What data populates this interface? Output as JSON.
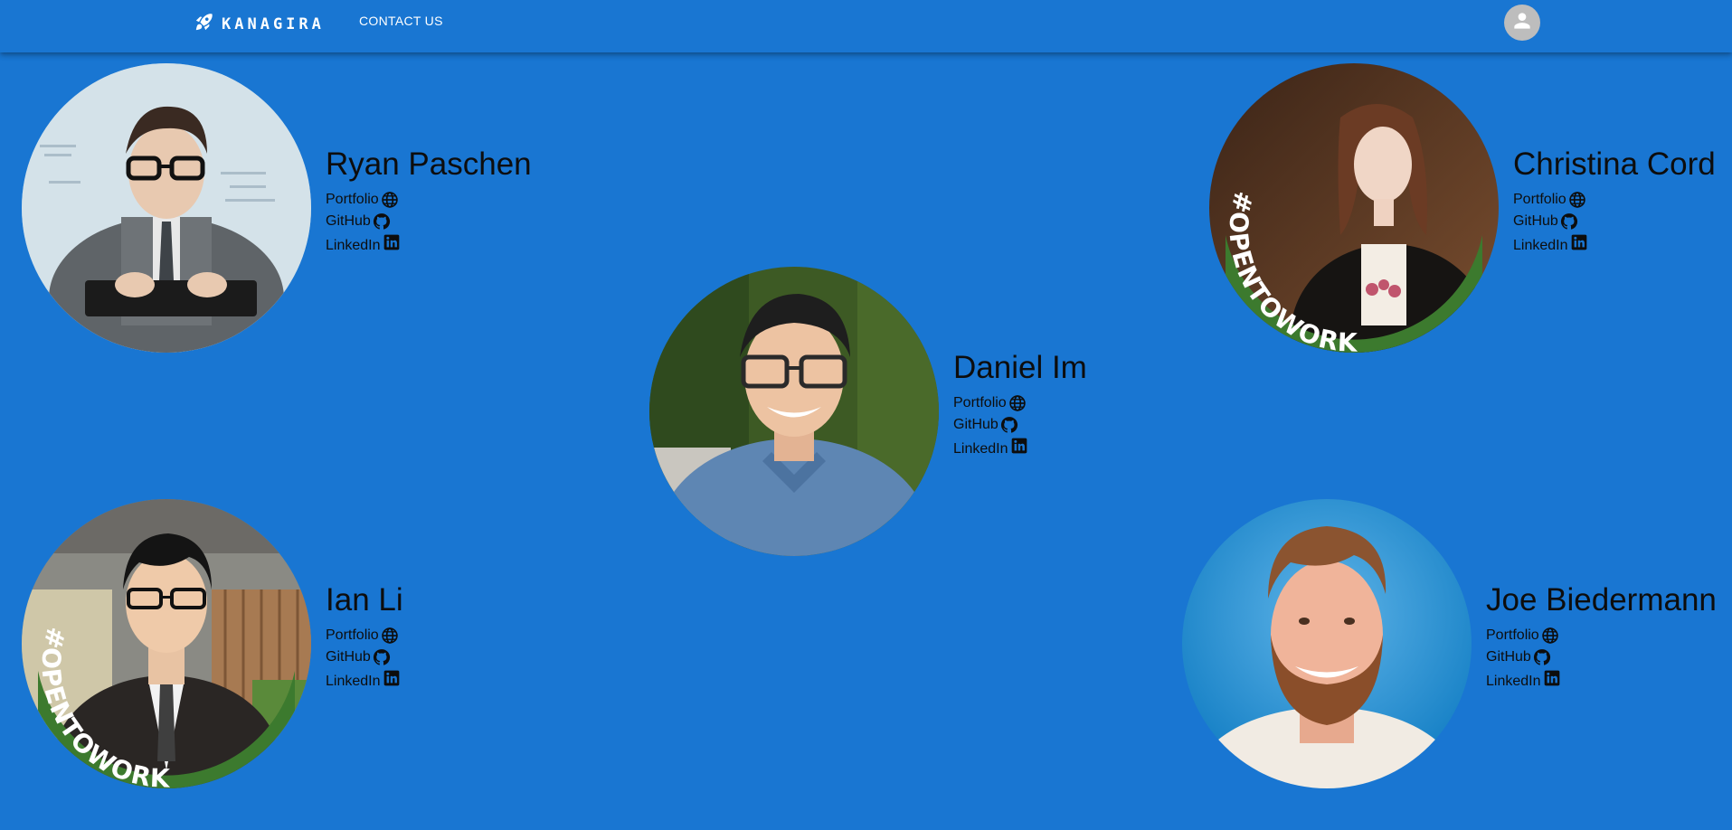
{
  "header": {
    "brand": "KANAGIRA",
    "nav_contact": "CONTACT US",
    "icons": {
      "brand": "rocket-icon",
      "account": "account-icon"
    }
  },
  "team": [
    {
      "name": "Ryan Paschen",
      "badge": "",
      "links": {
        "portfolio": "Portfolio",
        "github": "GitHub",
        "linkedin": "LinkedIn"
      }
    },
    {
      "name": "Christina Cord",
      "badge": "#OPENTOWORK",
      "links": {
        "portfolio": "Portfolio",
        "github": "GitHub",
        "linkedin": "LinkedIn"
      }
    },
    {
      "name": "Daniel Im",
      "badge": "",
      "links": {
        "portfolio": "Portfolio",
        "github": "GitHub",
        "linkedin": "LinkedIn"
      }
    },
    {
      "name": "Ian Li",
      "badge": "#OPENTOWORK",
      "links": {
        "portfolio": "Portfolio",
        "github": "GitHub",
        "linkedin": "LinkedIn"
      }
    },
    {
      "name": "Joe Biedermann",
      "badge": "",
      "links": {
        "portfolio": "Portfolio",
        "github": "GitHub",
        "linkedin": "LinkedIn"
      }
    }
  ],
  "colors": {
    "background": "#1976d2",
    "text": "#0d0d0d",
    "avatar": "#bdbdbd",
    "open_to_work_green": "#3c7a2e"
  }
}
